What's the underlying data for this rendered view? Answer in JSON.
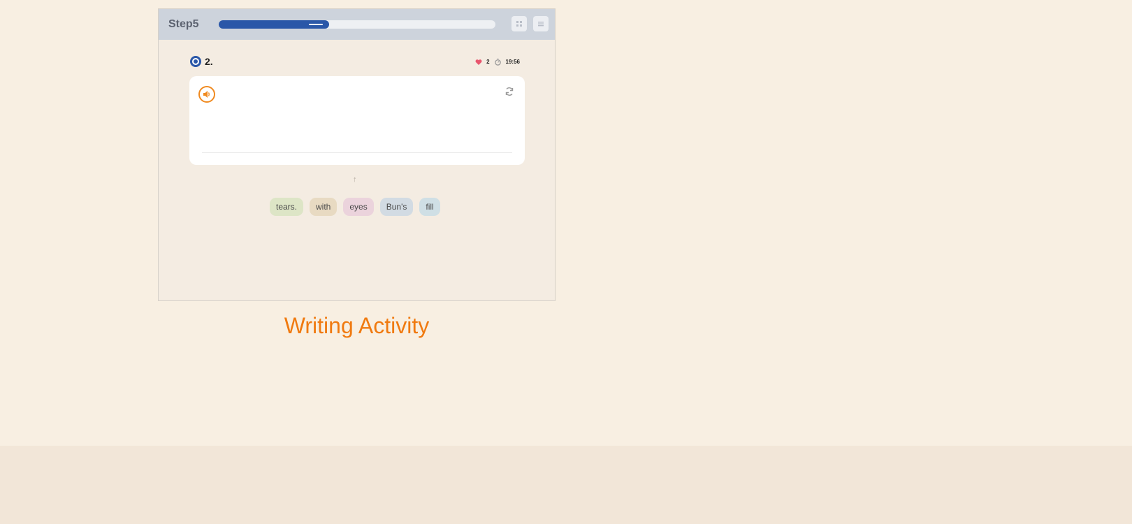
{
  "header": {
    "step_label": "Step5",
    "progress": 0.4,
    "buttons": [
      {
        "name": "grid-view-button",
        "icon": "grid-icon"
      },
      {
        "name": "menu-button",
        "icon": "list-icon"
      }
    ]
  },
  "question": {
    "number": "2.",
    "icon": "question-badge-icon"
  },
  "status": {
    "hearts": "2",
    "timer": "19:56"
  },
  "answer_card": {
    "audio_icon": "speaker-icon",
    "refresh_icon": "refresh-icon"
  },
  "word_bank": {
    "words": [
      {
        "text": "tears.",
        "color": "#dde5c6"
      },
      {
        "text": "with",
        "color": "#e8dac2"
      },
      {
        "text": "eyes",
        "color": "#ebd3dc"
      },
      {
        "text": "Bun's",
        "color": "#d2dbe3"
      },
      {
        "text": "fill",
        "color": "#cfdfe5"
      }
    ]
  },
  "caption": "Writing Activity",
  "colors": {
    "accent_orange": "#f07a10",
    "primary_blue": "#2a57a8",
    "topbar": "#cdd3dc",
    "page_bg": "#f8efe2"
  }
}
